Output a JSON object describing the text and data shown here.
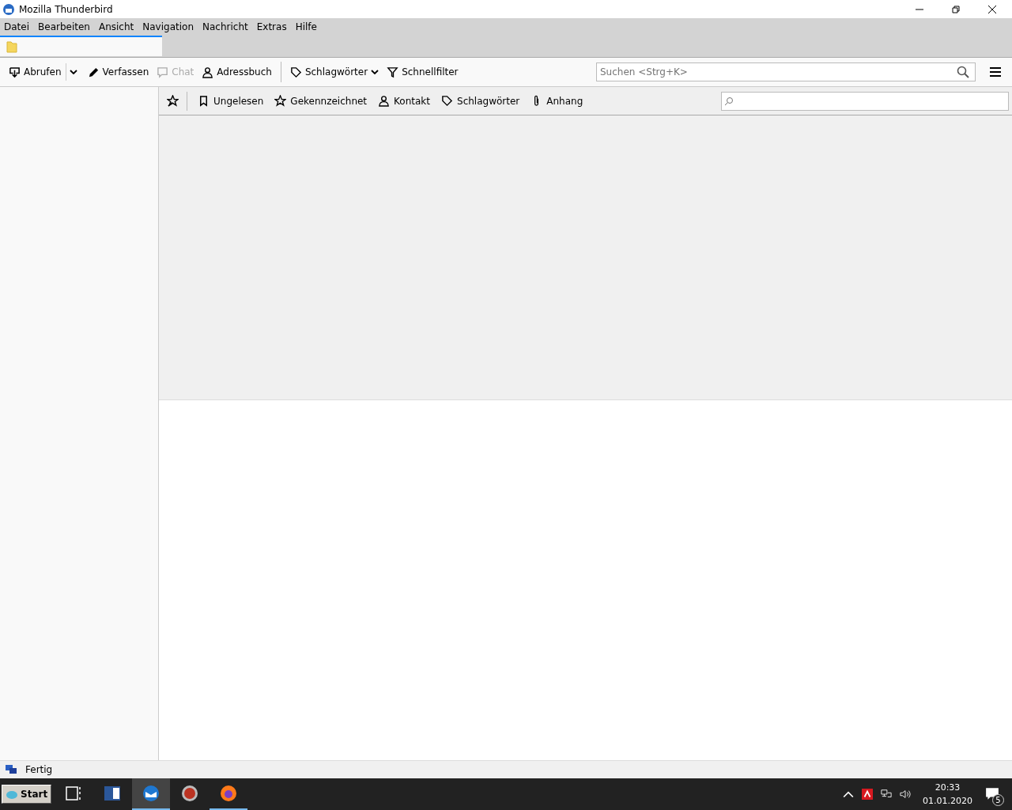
{
  "window": {
    "title": "Mozilla Thunderbird"
  },
  "menu": [
    "Datei",
    "Bearbeiten",
    "Ansicht",
    "Navigation",
    "Nachricht",
    "Extras",
    "Hilfe"
  ],
  "tabs": [
    {
      "selected": true
    }
  ],
  "toolbar": {
    "buttons": [
      {
        "label": "Abrufen",
        "disabled": false
      },
      {
        "label": "Verfassen",
        "disabled": false
      },
      {
        "label": "Chat",
        "disabled": true
      },
      {
        "label": "Adressbuch",
        "disabled": false
      },
      {
        "label": "Schlagwörter",
        "disabled": false
      },
      {
        "label": "Schnellfilter",
        "disabled": false
      }
    ],
    "search": {
      "placeholder": "Suchen <Strg+K>"
    }
  },
  "quick_filter": {
    "buttons": [
      {
        "label": "Ungelesen",
        "selected": false
      },
      {
        "label": "Gekennzeichnet",
        "selected": false
      },
      {
        "label": "Kontakt",
        "selected": false
      },
      {
        "label": "Schlagwörter",
        "selected": false
      },
      {
        "label": "Anhang",
        "selected": false
      }
    ]
  },
  "status_bar": {
    "text": "Fertig"
  },
  "taskbar": {
    "start": "Start",
    "apps": [
      {
        "selected": false,
        "running": false
      },
      {
        "selected": false,
        "running": false
      },
      {
        "selected": true,
        "running": true
      },
      {
        "selected": false,
        "running": false
      },
      {
        "selected": false,
        "running": true
      }
    ],
    "time": "20:33",
    "date": "01.01.2020",
    "notifications": "5"
  }
}
